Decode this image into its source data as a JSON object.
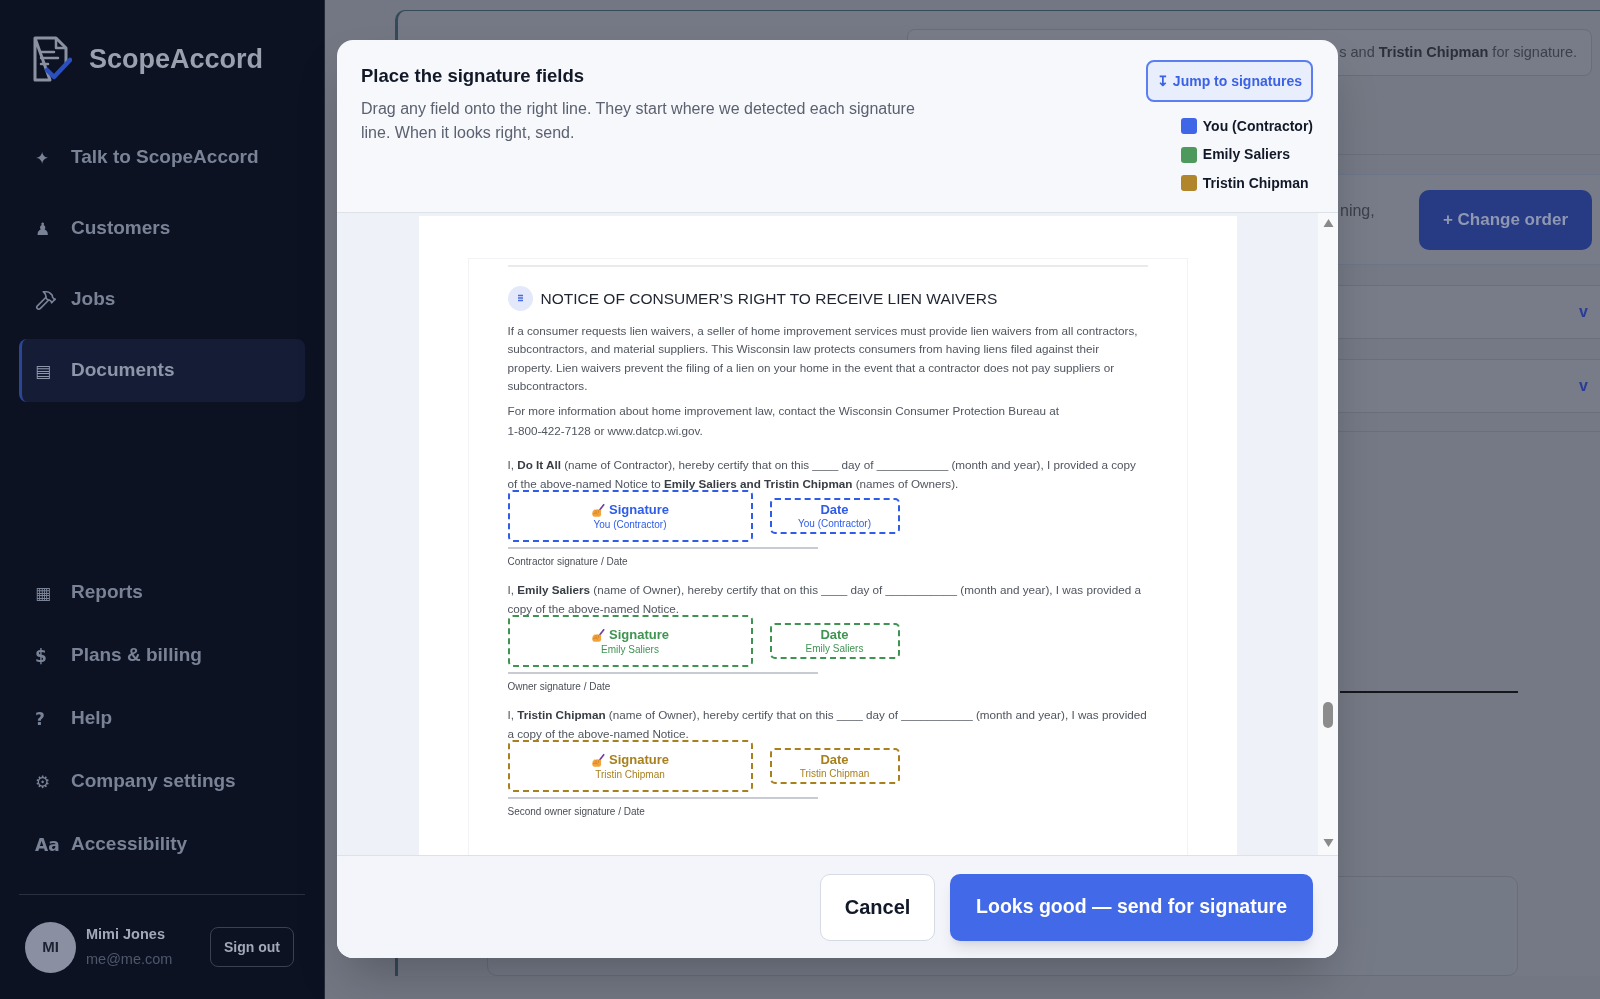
{
  "sidebar": {
    "brand": "ScopeAccord",
    "nav": [
      {
        "kind": "glyph",
        "icon": "✦",
        "label": "Talk to ScopeAccord",
        "selected": false
      },
      {
        "kind": "glyph",
        "icon": "♟",
        "label": "Customers",
        "selected": false
      },
      {
        "kind": "hammer",
        "label": "Jobs",
        "selected": false
      },
      {
        "kind": "glyph",
        "icon": "▤",
        "label": "Documents",
        "selected": true
      }
    ],
    "nav_bottom": [
      {
        "kind": "glyph",
        "icon": "▦",
        "label": "Reports",
        "selected": false
      },
      {
        "kind": "glyph",
        "icon": "$",
        "label": "Plans & billing",
        "selected": false
      },
      {
        "kind": "glyph",
        "icon": "?",
        "label": "Help",
        "selected": false
      },
      {
        "kind": "glyph",
        "icon": "⚙",
        "label": "Company settings",
        "selected": false
      },
      {
        "kind": "glyph",
        "icon": "Aa",
        "label": "Accessibility",
        "selected": false
      }
    ],
    "user": {
      "initials": "MI",
      "name": "Mimi Jones",
      "email": "me@me.com",
      "sign_out": "Sign out"
    }
  },
  "page_behind": {
    "banner": "s and **Tristin Chipman** for signature.",
    "card_text": "ning,",
    "change_order": "+ Change order",
    "rows": [
      {
        "toggle": "v"
      },
      {
        "toggle": "v"
      }
    ]
  },
  "modal": {
    "title": "Place the signature fields",
    "description": "Drag any field onto the right line. They start where we detected each signature line. When it looks right, send.",
    "jump_button": "↧ Jump to signatures",
    "signers": [
      {
        "name": "You (Contractor)",
        "color": "#3f66e6"
      },
      {
        "name": "Emily Saliers",
        "color": "#4e9a5c"
      },
      {
        "name": "Tristin Chipman",
        "color": "#b0852c"
      }
    ],
    "document": {
      "heading": "NOTICE OF CONSUMER’S RIGHT TO RECEIVE LIEN WAIVERS",
      "paragraphs": [
        "If a consumer requests lien waivers, a seller of home improvement services must provide lien waivers from all contractors, subcontractors, and material suppliers. This Wisconsin law protects consumers from having liens filed against their property. Lien waivers prevent the filing of a lien on your home in the event that a contractor does not pay suppliers or subcontractors.",
        "For more information about home improvement law, contact the Wisconsin Consumer Protection Bureau at\n1-800-422-7128 or www.datcp.wi.gov."
      ],
      "sections": [
        {
          "certification": "I, **Do It All** (name of Contractor), hereby certify that on this ____ day of ___________ (month and year), I provided a copy of the above-named Notice to **Emily Saliers and Tristin Chipman** (names of Owners).",
          "fields": [
            {
              "kind": "signature",
              "label": "Signature",
              "signer": "You (Contractor)",
              "color": "#2f5ce8"
            },
            {
              "kind": "date",
              "label": "Date",
              "signer": "You (Contractor)",
              "color": "#2f5ce8"
            }
          ],
          "line_label": "Contractor signature / Date"
        },
        {
          "certification": "I, **Emily Saliers** (name of Owner), hereby certify that on this ____ day of ___________ (month and year), I was provided a copy of the above-named Notice.",
          "fields": [
            {
              "kind": "signature",
              "label": "Signature",
              "signer": "Emily Saliers",
              "color": "#3f9452"
            },
            {
              "kind": "date",
              "label": "Date",
              "signer": "Emily Saliers",
              "color": "#3f9452"
            }
          ],
          "line_label": "Owner signature / Date"
        },
        {
          "certification": "I, **Tristin Chipman** (name of Owner), hereby certify that on this ____ day of ___________ (month and year), I was provided a copy of the above-named Notice.",
          "fields": [
            {
              "kind": "signature",
              "label": "Signature",
              "signer": "Tristin Chipman",
              "color": "#a8801e"
            },
            {
              "kind": "date",
              "label": "Date",
              "signer": "Tristin Chipman",
              "color": "#a8801e"
            }
          ],
          "line_label": "Second owner signature / Date"
        }
      ]
    },
    "buttons": {
      "cancel": "Cancel",
      "send": "Looks good — send for signature"
    }
  }
}
